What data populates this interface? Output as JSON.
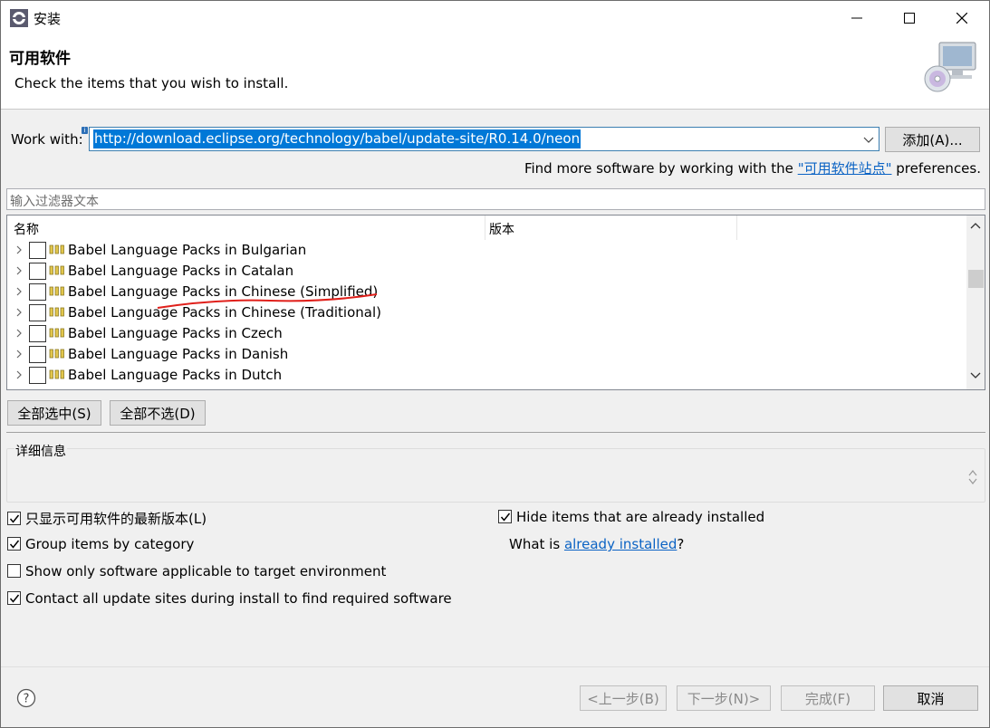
{
  "window": {
    "title": "安装",
    "controls": [
      "minimize",
      "maximize",
      "close"
    ]
  },
  "banner": {
    "title": "可用软件",
    "description": "Check the items that you wish to install."
  },
  "work_with": {
    "label": "Work with:",
    "value": "http://download.eclipse.org/technology/babel/update-site/R0.14.0/neon",
    "add_button": "添加(A)...",
    "find_more_prefix": "Find more software by working with the ",
    "find_more_link": "\"可用软件站点\"",
    "find_more_suffix": " preferences."
  },
  "filter": {
    "placeholder": "输入过滤器文本"
  },
  "tree": {
    "columns": [
      "名称",
      "版本"
    ],
    "rows": [
      {
        "label": "Babel Language Packs in Bulgarian",
        "checked": false
      },
      {
        "label": "Babel Language Packs in Catalan",
        "checked": false
      },
      {
        "label": "Babel Language Packs in Chinese (Simplified)",
        "checked": false,
        "annotated": true
      },
      {
        "label": "Babel Language Packs in Chinese (Traditional)",
        "checked": false
      },
      {
        "label": "Babel Language Packs in Czech",
        "checked": false
      },
      {
        "label": "Babel Language Packs in Danish",
        "checked": false
      },
      {
        "label": "Babel Language Packs in Dutch",
        "checked": false
      }
    ]
  },
  "buttons": {
    "select_all": "全部选中(S)",
    "deselect_all": "全部不选(D)",
    "back": "<上一步(B)",
    "next": "下一步(N)>",
    "finish": "完成(F)",
    "cancel": "取消"
  },
  "details": {
    "label": "详细信息"
  },
  "options": {
    "latest_only": {
      "label": "只显示可用软件的最新版本(L)",
      "checked": true
    },
    "group_by_category": {
      "label": "Group items by category",
      "checked": true
    },
    "target_env_only": {
      "label": "Show only software applicable to target environment",
      "checked": false
    },
    "contact_all_sites": {
      "label": "Contact all update sites during install to find required software",
      "checked": true
    },
    "hide_installed": {
      "label": "Hide items that are already installed",
      "checked": true
    },
    "what_is_prefix": "What is ",
    "what_is_link": "already installed",
    "what_is_suffix": "?"
  },
  "colors": {
    "selection": "#0078d7",
    "link": "#0b63c4",
    "annotation": "#e0201b"
  }
}
